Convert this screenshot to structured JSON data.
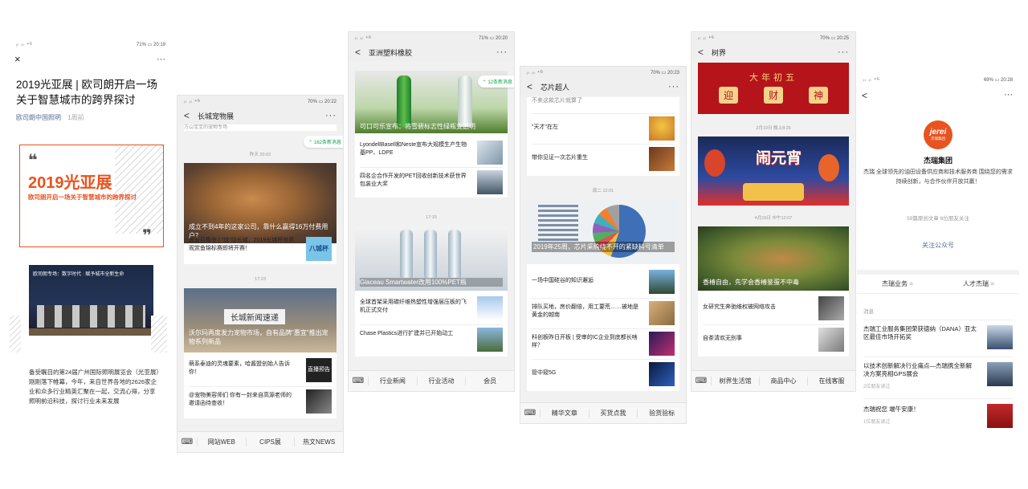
{
  "status_bars": {
    "p1": {
      "signal": "ᵢₗ ᵢₗ ⁴ᴳ",
      "right": "71% ▭ 20:19"
    },
    "p2": {
      "signal": "ᵢₗ ᵢₗ ⁴ᴳ",
      "right": "70% ▭ 20:22"
    },
    "p3": {
      "signal": "ᵢₗ ᵢₗ ⁴ᴳ",
      "right": "71% ▭ 20:20"
    },
    "p4": {
      "signal": "ᵢₗ ᵢₗ ⁴ᴳ",
      "right": "70% ▭ 20:23"
    },
    "p5": {
      "signal": "ᵢₗ ᵢₗ ⁴ᴳ",
      "right": "70% ▭ 20:25"
    },
    "p6": {
      "signal": "ᵢₗ ᵢₗ ⁴ᴳ",
      "right": "69% ▭ 20:28"
    }
  },
  "article": {
    "close": "×",
    "more": "···",
    "title": "2019光亚展 | 欧司朗开启一场关于智慧城市的跨界探讨",
    "author": "欧司朗中国照明",
    "time": "1周前",
    "banner_title": "2019光亚展",
    "banner_sub": "欧司朗开启一场关于智慧城市的跨界探讨",
    "photo_caption": "欧司朗专场：数字时代 · 赋予城市全新生命",
    "body": "备受瞩目的第24届广州国际照明展览会（光亚展）刚刚落下帷幕，今年，来自世界各地的2626家企业和众多行业精英汇聚在一起，交流心得，分享照明前沿科技，探讨行业未来发展"
  },
  "changcheng": {
    "title": "长城宠物展",
    "back": "<",
    "more": "···",
    "top_fade": "方山宝宝的宠物专场",
    "new_msgs": "162条新消息",
    "ts1": "昨天 20:03",
    "hero1_title": "成立不到4年的这家公司，靠什么赢得16万付费用户？",
    "row1": "鱼友召集令 | \"炫\"动长城，2019长城杯世界观赏鱼锦标赛即将开赛！",
    "row1_thumb": "八城杯",
    "ts2": "17:23",
    "hero2_sign": "长城新闻速递",
    "hero2_title": "沃尔玛再度发力宠物市场，自有品牌\"惠宜\"推出宠物系列新品",
    "row2": "萌系泰迪的灵魂要素，哈酱盟创始人告诉你！",
    "row2_thumb": "直播预告",
    "row3": "@宠物美容师们 你有一封来自高源老师的邀请函待查收！",
    "menu": [
      "网站WEB",
      "CIPS展",
      "热文NEWS"
    ]
  },
  "yazhou": {
    "title": "亚洲塑料橡胶",
    "back": "<",
    "more": "···",
    "new_msgs": "12条新消息",
    "hero1_title": "可口可乐宣布：将雪碧标志性绿瓶变透明",
    "row1": "LyondellBasell和Neste宣布大规模生产生物基PP、LDPE",
    "row2": "四名企合作开发的PET回收创新技术获世界包装业大奖",
    "ts": "17:15",
    "hero2_title": "Glaceau Smartwater改用100%PET瓶",
    "row3": "全球首架采用碳纤维热塑性增强层压板的飞机正式交付",
    "row4": "Chase Plastics进行扩建并已开始动工",
    "menu": [
      "行业新闻",
      "行业活动",
      "会员"
    ]
  },
  "xinpian": {
    "title": "芯片超人",
    "back": "<",
    "more": "···",
    "row0": "不卖这款芯片就算了",
    "row1": "\"天才\"在左",
    "row2": "带你见证一次芯片重生",
    "ts": "周二 12:01",
    "hero_title": "2019年25周，芯片采购绕不开的紧缺料号清单",
    "row3": "一场中国硅谷的知识邂逅",
    "row4": "排队买地，房价翻倍，用工要荒……被地是黄金的越南",
    "row5": "科创板昨日开板 | 受审的IC企业到底都长啥样？",
    "row6": "管中窥5G",
    "menu": [
      "精华文章",
      "买货点我",
      "验货验标"
    ]
  },
  "shujie": {
    "title": "树界",
    "back": "<",
    "more": "···",
    "banner_top": "大年初五",
    "banner_chars": [
      "迎",
      "财",
      "神"
    ],
    "ts1": "2月19日 晚上8:26",
    "lantern_text": "闹元宵",
    "ts2": "4月15日 中午12:07",
    "hero_title": "香椿自由，先学会香椿鉴蛋不中毒",
    "row1": "女研究生奔驰维权被网络攻击",
    "row2": "自茶清欢无别事",
    "menu": [
      "树界生活馆",
      "商品中心",
      "在线客服"
    ]
  },
  "jerei": {
    "back": "<",
    "more": "···",
    "logo_text": "jerei",
    "logo_sub": "杰瑞集团",
    "name": "杰瑞集团",
    "desc": "杰瑞 全球领先的油田设备供应商和技术服务商 围绕您的需求持续创新，与合作伙伴开放共赢！",
    "stats": "59篇原创文章 6位朋友关注",
    "follow": "关注公众号",
    "tab1": "杰瑞业务",
    "tab2": "人才杰瑞",
    "section": "消息",
    "item1": "杰瑞工业服务集团荣获德纳（DANA）亚太区最佳市场开拓奖",
    "item2": "以技术创新解决行业痛点—杰瑞携全新解决方案亮相GPS展会",
    "item2_meta": "2位朋友读过",
    "item3": "杰瑞祝您 端午安康！",
    "item3_meta": "1位朋友读过"
  },
  "colors": {
    "accent_orange": "#e8531f",
    "wechat_green": "#07a34a",
    "follow_blue": "#576b95",
    "festival_red": "#b5141a"
  }
}
